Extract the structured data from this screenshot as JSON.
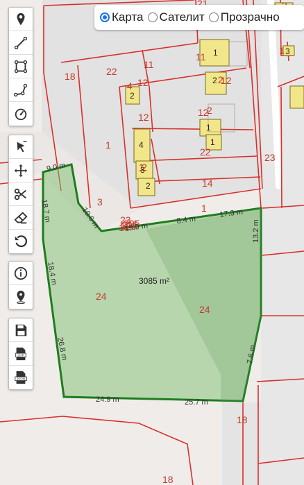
{
  "layer_switcher": {
    "options": [
      {
        "label": "Карта",
        "selected": true
      },
      {
        "label": "Сателит",
        "selected": false
      },
      {
        "label": "Прозрачно",
        "selected": false
      }
    ]
  },
  "toolbar": {
    "group1": [
      "marker-icon",
      "line-icon",
      "polygon-icon",
      "polyline-icon",
      "measure-circle-icon"
    ],
    "group2": [
      "cursor-edit-icon",
      "move-icon",
      "cut-icon",
      "eraser-icon",
      "undo-icon"
    ],
    "group3": [
      "info-icon",
      "location-pin-icon"
    ],
    "group4": [
      "save-icon",
      "shp-export-icon",
      "json-export-icon"
    ]
  },
  "map": {
    "selection_area": "3085 m²",
    "dimensions": [
      "9.0 m",
      "18.7 m",
      "10.6 m",
      "19.9 m",
      "8.4 m",
      "17.3 m",
      "13.2 m",
      "18.4 m",
      "26.8 m",
      "7.6 m",
      "24.9 m",
      "25.7 m"
    ],
    "plot_labels": [
      "21",
      "2",
      "11",
      "1",
      "18",
      "22",
      "11",
      "12",
      "4",
      "2",
      "12",
      "2",
      "12",
      "12",
      "3",
      "1",
      "1",
      "22",
      "2",
      "23",
      "23",
      "14",
      "3",
      "1",
      "24",
      "24",
      "18",
      "18",
      "205",
      "205",
      "120",
      "14"
    ],
    "building_labels": [
      "1",
      "2",
      "2",
      "1",
      "1",
      "4",
      "3",
      "2",
      "1",
      "3"
    ],
    "colors": {
      "selection_fill": "#7fbf6f",
      "selection_stroke": "#1e7d1e",
      "plot_line": "#d9302a",
      "plot_text": "#c43a2a",
      "building": "#f2e68a"
    }
  }
}
